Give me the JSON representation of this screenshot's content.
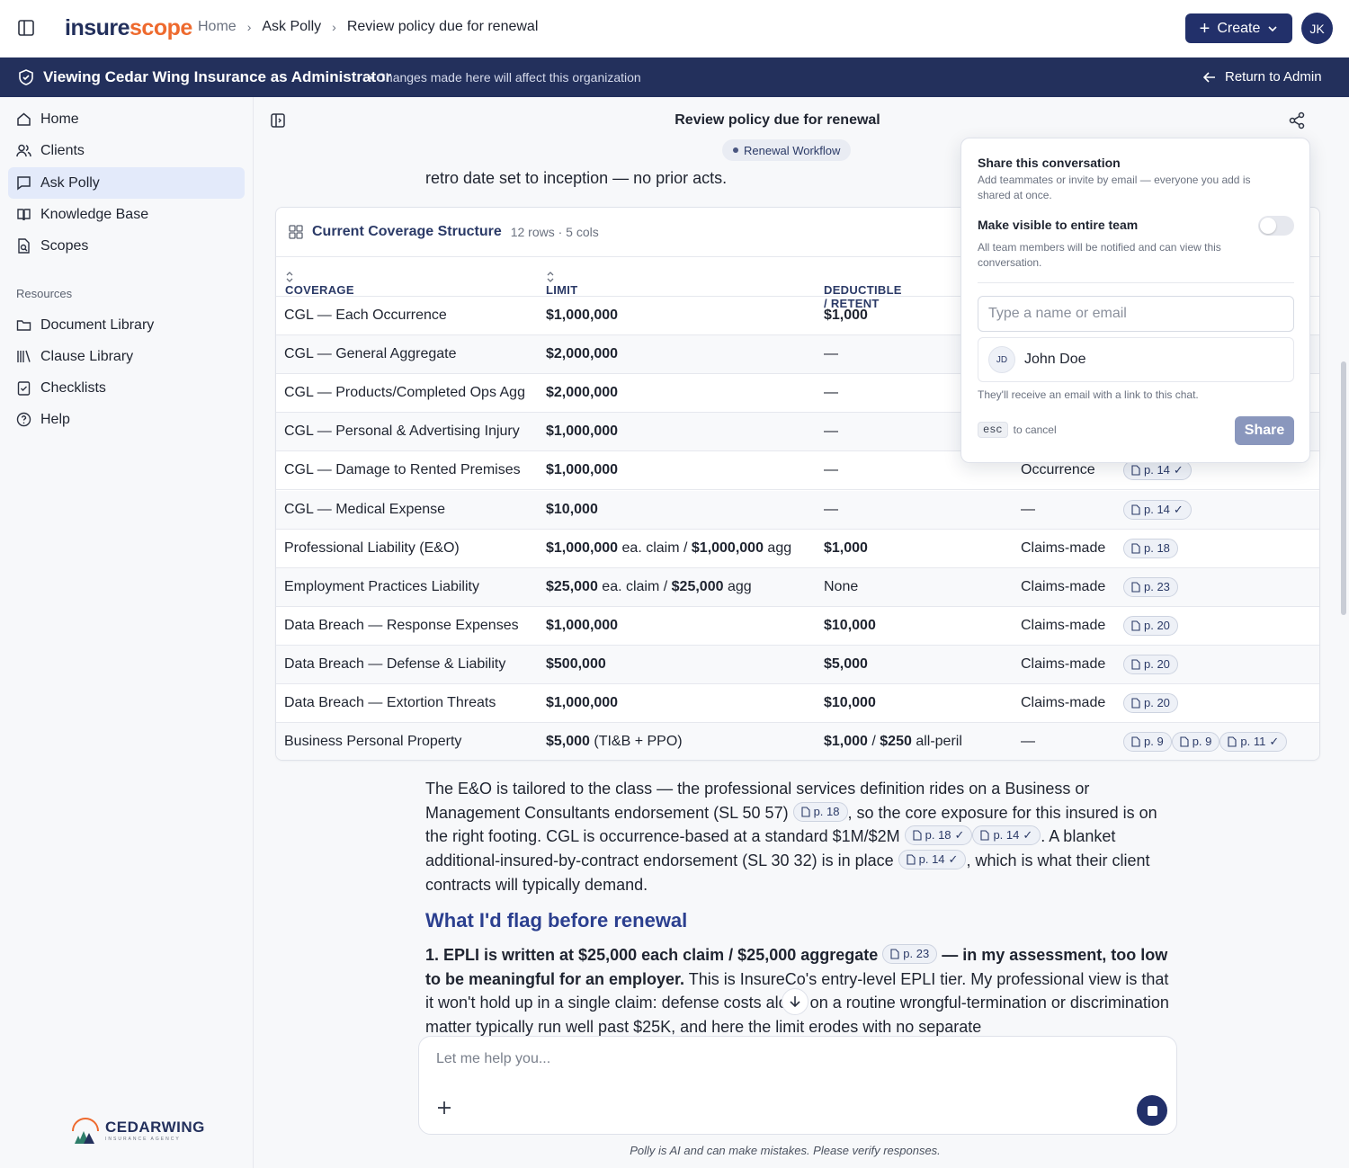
{
  "app": {
    "logo_main": "insure",
    "logo_accent": "scope"
  },
  "breadcrumb": [
    "Home",
    "Ask Polly",
    "Review policy due for renewal"
  ],
  "create_label": "Create",
  "user_initials": "JK",
  "banner": {
    "title": "Viewing Cedar Wing Insurance as Administrator",
    "subtitle": "• Changes made here will affect this organization",
    "return_label": "Return to Admin"
  },
  "sidebar": {
    "items": [
      {
        "label": "Home",
        "icon": "home-icon"
      },
      {
        "label": "Clients",
        "icon": "users-icon"
      },
      {
        "label": "Ask Polly",
        "icon": "chat-icon",
        "active": true
      },
      {
        "label": "Knowledge Base",
        "icon": "book-icon"
      },
      {
        "label": "Scopes",
        "icon": "scope-icon"
      }
    ],
    "resources_label": "Resources",
    "resources": [
      {
        "label": "Document Library",
        "icon": "folder-icon"
      },
      {
        "label": "Clause Library",
        "icon": "library-icon"
      },
      {
        "label": "Checklists",
        "icon": "checklist-icon"
      },
      {
        "label": "Help",
        "icon": "help-icon"
      }
    ],
    "brand_name": "CEDARWING",
    "brand_tag": "INSURANCE AGENCY"
  },
  "conversation": {
    "title": "Review policy due for renewal",
    "workflow": "Renewal Workflow",
    "intro_line": "retro date set to inception — no prior acts."
  },
  "table": {
    "title": "Current Coverage Structure",
    "meta": "12 rows · 5 cols",
    "columns": [
      "COVERAGE",
      "LIMIT",
      "DEDUCTIBLE / RETENT"
    ],
    "rows": [
      {
        "coverage": "CGL — Each Occurrence",
        "limit": "$1,000,000",
        "deductible": "$1,000",
        "trigger": "",
        "cites": []
      },
      {
        "coverage": "CGL — General Aggregate",
        "limit": "$2,000,000",
        "deductible": "—",
        "trigger": "",
        "cites": []
      },
      {
        "coverage": "CGL — Products/Completed Ops Agg",
        "limit": "$2,000,000",
        "deductible": "—",
        "trigger": "",
        "cites": []
      },
      {
        "coverage": "CGL — Personal & Advertising Injury",
        "limit": "$1,000,000",
        "deductible": "—",
        "trigger": "",
        "cites": []
      },
      {
        "coverage": "CGL — Damage to Rented Premises",
        "limit": "$1,000,000",
        "deductible": "—",
        "trigger": "Occurrence",
        "cites": [
          {
            "label": "p. 14",
            "verified": true
          }
        ]
      },
      {
        "coverage": "CGL — Medical Expense",
        "limit": "$10,000",
        "deductible": "—",
        "trigger": "—",
        "cites": [
          {
            "label": "p. 14",
            "verified": true
          }
        ]
      },
      {
        "coverage": "Professional Liability (E&O)",
        "limit_a": "$1,000,000",
        "limit_b": " ea. claim / ",
        "limit_c": "$1,000,000",
        "limit_d": " agg",
        "deductible": "$1,000",
        "trigger": "Claims-made",
        "cites": [
          {
            "label": "p. 18",
            "verified": false
          }
        ]
      },
      {
        "coverage": "Employment Practices Liability",
        "limit_a": "$25,000",
        "limit_b": " ea. claim / ",
        "limit_c": "$25,000",
        "limit_d": " agg",
        "deductible": "None",
        "trigger": "Claims-made",
        "cites": [
          {
            "label": "p. 23",
            "verified": false
          }
        ]
      },
      {
        "coverage": "Data Breach — Response Expenses",
        "limit": "$1,000,000",
        "deductible": "$10,000",
        "trigger": "Claims-made",
        "cites": [
          {
            "label": "p. 20",
            "verified": false
          }
        ]
      },
      {
        "coverage": "Data Breach — Defense & Liability",
        "limit": "$500,000",
        "deductible": "$5,000",
        "trigger": "Claims-made",
        "cites": [
          {
            "label": "p. 20",
            "verified": false
          }
        ]
      },
      {
        "coverage": "Data Breach — Extortion Threats",
        "limit": "$1,000,000",
        "deductible": "$10,000",
        "trigger": "Claims-made",
        "cites": [
          {
            "label": "p. 20",
            "verified": false
          }
        ]
      },
      {
        "coverage": "Business Personal Property",
        "limit_a": "$5,000",
        "limit_b": " (TI&B + PPO)",
        "ded_a": "$1,000",
        "ded_b": " / ",
        "ded_c": "$250",
        "ded_d": " all-peril",
        "trigger": "—",
        "cites": [
          {
            "label": "p. 9",
            "verified": false
          },
          {
            "label": "p. 9",
            "verified": false
          },
          {
            "label": "p. 11",
            "verified": true
          }
        ]
      }
    ]
  },
  "body": {
    "p1": {
      "a": "The E&O is tailored to the class — the professional services definition rides on a Business or Management Consultants endorsement (SL 50 57) ",
      "cite1": "p. 18",
      "b": ", so the core exposure for this insured is on the right footing. CGL is occurrence-based at a standard $1M/$2M ",
      "cite2": "p. 18",
      "cite3": "p. 14",
      "c": ". A blanket additional-insured-by-contract endorsement (SL 30 32) is in place ",
      "cite4": "p. 14",
      "d": ", which is what their client contracts will typically demand."
    },
    "heading": "What I'd flag before renewal",
    "p2": {
      "bold_a": "1. EPLI is written at $25,000 each claim / $25,000 aggregate",
      "cite": "p. 23",
      "bold_b": " — in my assessment, too low to be meaningful for an employer.",
      "rest": " This is InsureCo's entry-level EPLI tier. My professional view is that it won't hold up in a single claim: defense costs alone on a routine wrongful-termination or discrimination matter typically run well past $25K, and here the limit erodes with no separate"
    }
  },
  "share": {
    "title": "Share this conversation",
    "desc": "Add teammates or invite by email — everyone you add is shared at once.",
    "visible_title": "Make visible to entire team",
    "visible_desc": "All team members will be notified and can view this conversation.",
    "visible_on": false,
    "email_placeholder": "Type a name or email",
    "suggest_initials": "JD",
    "suggest_name": "John Doe",
    "note": "They'll receive an email with a link to this chat.",
    "esc_key": "esc",
    "esc_label": "to cancel",
    "share_label": "Share"
  },
  "composer": {
    "placeholder": "Let me help you...",
    "disclaimer": "Polly is AI and can make mistakes. Please verify responses."
  }
}
